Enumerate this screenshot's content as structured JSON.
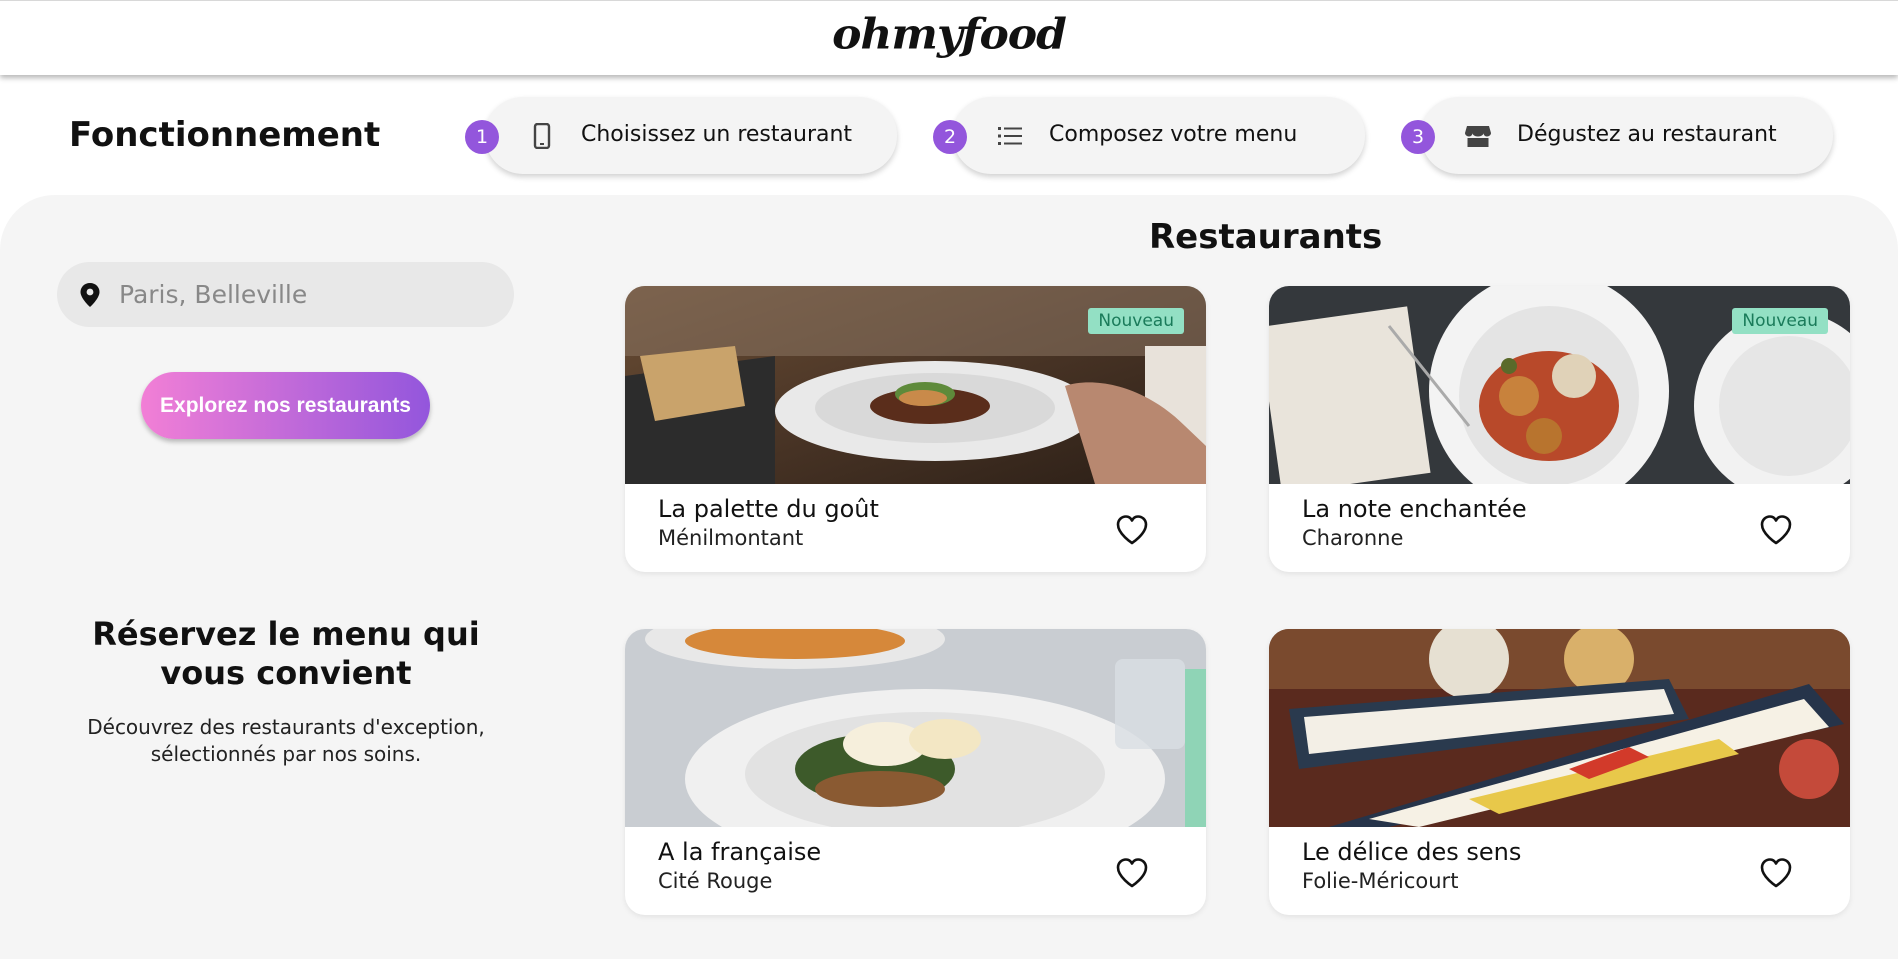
{
  "header": {
    "logo": "ohmyfood"
  },
  "how_it_works": {
    "title": "Fonctionnement",
    "steps": [
      {
        "number": "1",
        "icon": "smartphone-icon",
        "label": "Choisissez un restaurant"
      },
      {
        "number": "2",
        "icon": "list-icon",
        "label": "Composez votre menu"
      },
      {
        "number": "3",
        "icon": "store-icon",
        "label": "Dégustez au restaurant"
      }
    ]
  },
  "search": {
    "placeholder": "Paris, Belleville",
    "icon": "map-pin-icon"
  },
  "explore_button": {
    "label": "Explorez nos restaurants"
  },
  "reserve": {
    "title": "Réservez le menu qui vous convient",
    "description": "Découvrez des restaurants d'exception, sélectionnés par nos soins."
  },
  "restaurants": {
    "title": "Restaurants",
    "items": [
      {
        "name": "La palette du goût",
        "area": "Ménilmontant",
        "badge": "Nouveau",
        "favorite_icon": "heart-icon"
      },
      {
        "name": "La note enchantée",
        "area": "Charonne",
        "badge": "Nouveau",
        "favorite_icon": "heart-icon"
      },
      {
        "name": "A la française",
        "area": "Cité Rouge",
        "badge": "",
        "favorite_icon": "heart-icon"
      },
      {
        "name": "Le délice des sens",
        "area": "Folie-Méricourt",
        "badge": "",
        "favorite_icon": "heart-icon"
      }
    ]
  },
  "colors": {
    "accent_purple": "#9356dc",
    "accent_pink": "#f27fd6",
    "badge_bg": "#93e0c4",
    "badge_text": "#1a7b5a",
    "background": "#f5f5f5"
  }
}
